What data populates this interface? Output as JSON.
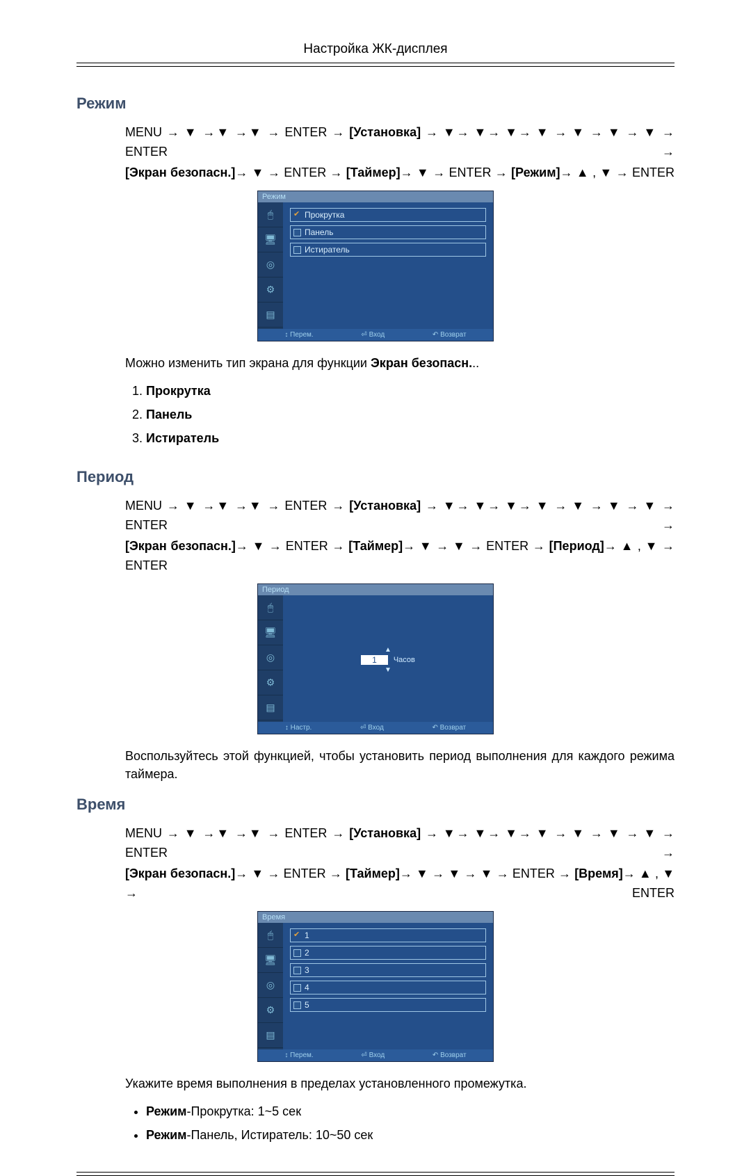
{
  "page_header": "Настройка ЖК-дисплея",
  "sections": {
    "mode": {
      "title": "Режим",
      "path_line1_pre": "MENU → ▼ →▼ →▼ → ENTER → ",
      "path_line1_b1": "[Установка]",
      "path_line1_mid": " → ▼→ ▼→ ▼→ ▼ → ▼ → ▼ → ▼ → ENTER →",
      "path_line2_b1": "[Экран безопасн.]",
      "path_line2_a": "→ ▼ → ENTER → ",
      "path_line2_b2": "[Таймер]",
      "path_line2_b": "→ ▼ → ENTER → ",
      "path_line2_b3": "[Режим]",
      "path_line2_c": "→ ▲ , ▼ → ENTER",
      "osd": {
        "title": "Режим",
        "items": [
          "Прокрутка",
          "Панель",
          "Истиратель"
        ],
        "footer": [
          "↕ Перем.",
          "⏎ Вход",
          "↶ Возврат"
        ]
      },
      "desc_pre": "Можно изменить тип экрана для функции ",
      "desc_b": "Экран безопасн.",
      "desc_post": "..",
      "options": [
        "Прокрутка",
        "Панель",
        "Истиратель"
      ]
    },
    "period": {
      "title": "Период",
      "path_line1_pre": "MENU → ▼ →▼ →▼ → ENTER → ",
      "path_line1_b1": "[Установка]",
      "path_line1_mid": " → ▼→ ▼→ ▼→ ▼ → ▼ → ▼ → ▼ → ENTER →",
      "path_line2_b1": "[Экран безопасн.]",
      "path_line2_a": "→ ▼ → ENTER → ",
      "path_line2_b2": "[Таймер]",
      "path_line2_b": "→ ▼ → ▼ → ENTER → ",
      "path_line2_b3": "[Период]",
      "path_line2_c": "→ ▲ , ▼ → ENTER",
      "osd": {
        "title": "Период",
        "value": "1",
        "unit": "Часов",
        "footer": [
          "↕ Настр.",
          "⏎ Вход",
          "↶ Возврат"
        ]
      },
      "desc": "Воспользуйтесь этой функцией, чтобы установить период выполнения для каждого режима таймера."
    },
    "time": {
      "title": "Время",
      "path_line1_pre": "MENU → ▼ →▼ →▼ → ENTER → ",
      "path_line1_b1": "[Установка]",
      "path_line1_mid": " → ▼→ ▼→ ▼→ ▼ → ▼ → ▼ → ▼ → ENTER →",
      "path_line2_b1": "[Экран безопасн.]",
      "path_line2_a": "→ ▼ → ENTER → ",
      "path_line2_b2": "[Таймер]",
      "path_line2_b": "→ ▼ → ▼ → ▼ → ENTER → ",
      "path_line2_b3": "[Время]",
      "path_line2_c": "→ ▲ , ▼ → ENTER",
      "osd": {
        "title": "Время",
        "items": [
          "1",
          "2",
          "3",
          "4",
          "5"
        ],
        "footer": [
          "↕ Перем.",
          "⏎ Вход",
          "↶ Возврат"
        ]
      },
      "desc": "Укажите время выполнения в пределах установленного промежутка.",
      "bullets": [
        {
          "b": "Режим",
          "rest": "-Прокрутка: 1~5 сек"
        },
        {
          "b": "Режим",
          "rest": "-Панель, Истиратель: 10~50 сек"
        }
      ]
    }
  },
  "icons": [
    "🖱",
    "🖥",
    "◎",
    "⚙",
    "▤"
  ]
}
